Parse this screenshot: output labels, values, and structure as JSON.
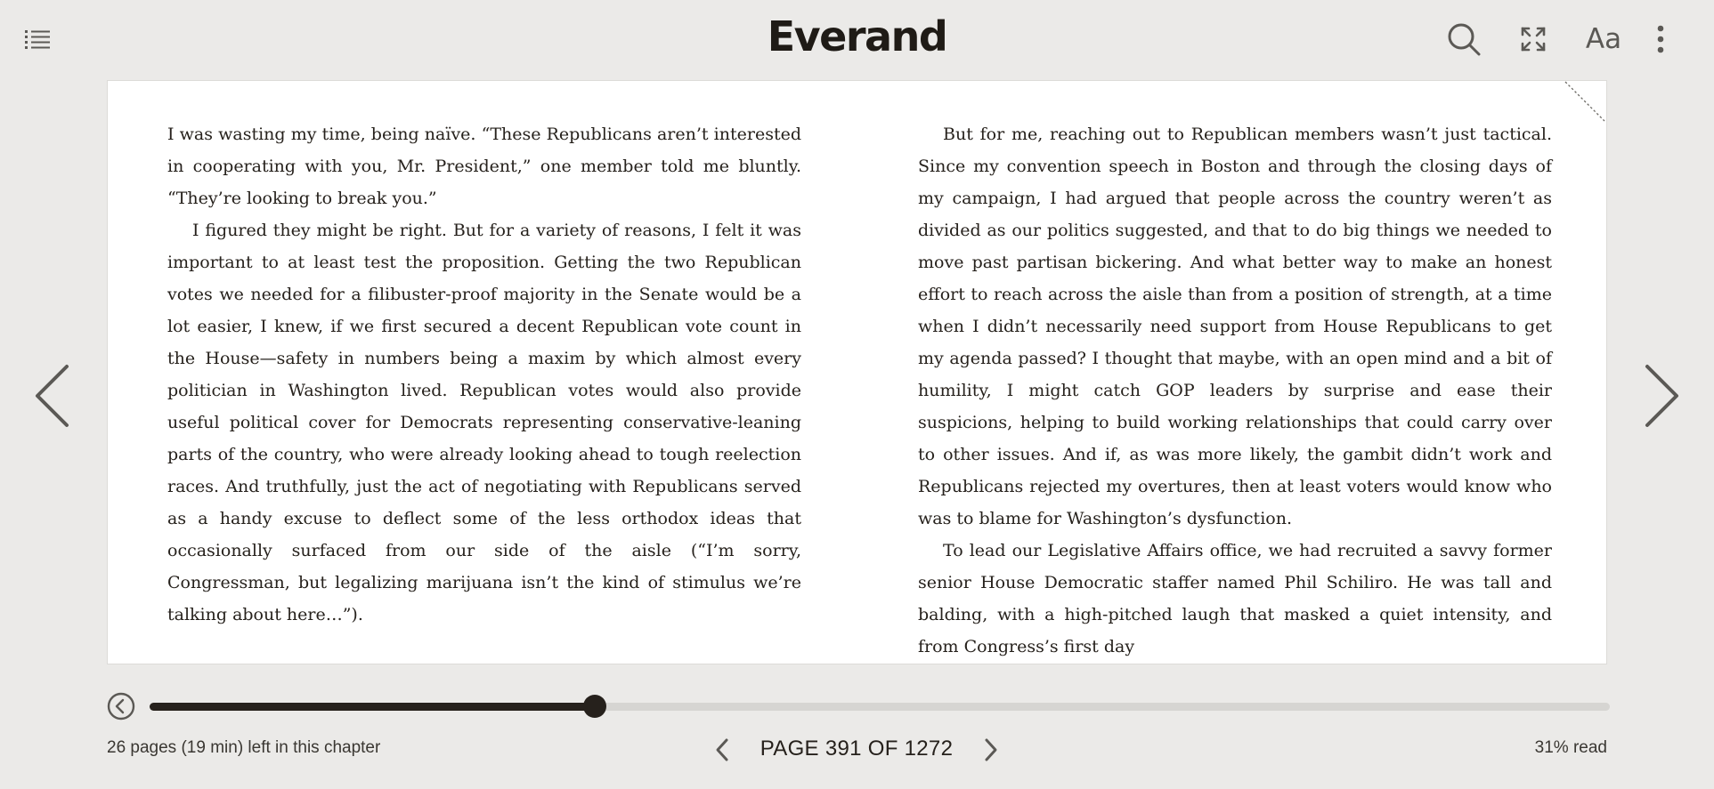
{
  "header": {
    "logo": "Everand",
    "icons": {
      "toc": "list-icon",
      "search": "search-icon",
      "fullscreen": "expand-icon",
      "font": "Aa",
      "more": "more-vertical-icon"
    }
  },
  "content": {
    "left_paragraphs": [
      "I was wasting my time, being naïve. “These Republicans aren’t interested in cooperating with you, Mr. President,” one member told me bluntly. “They’re looking to break you.”",
      "I figured they might be right. But for a variety of reasons, I felt it was important to at least test the proposition. Getting the two Republican votes we needed for a filibuster-proof majority in the Senate would be a lot easier, I knew, if we first secured a decent Republican vote count in the House—safety in numbers being a maxim by which almost every politician in Washington lived. Republican votes would also provide useful political cover for Democrats representing conservative-leaning parts of the country, who were already looking ahead to tough reelection races. And truthfully, just the act of negotiating with Republicans served as a handy excuse to deflect some of the less orthodox ideas that occasionally surfaced from our side of the aisle (“I’m sorry, Congressman, but legalizing marijuana isn’t the kind of stimulus we’re talking about here…”)."
    ],
    "right_paragraphs": [
      "But for me, reaching out to Republican members wasn’t just tactical. Since my convention speech in Boston and through the closing days of my campaign, I had argued that people across the country weren’t as divided as our politics suggested, and that to do big things we needed to move past partisan bickering. And what better way to make an honest effort to reach across the aisle than from a position of strength, at a time when I didn’t necessarily need support from House Republicans to get my agenda passed? I thought that maybe, with an open mind and a bit of humility, I might catch GOP leaders by surprise and ease their suspicions, helping to build working relationships that could carry over to other issues. And if, as was more likely, the gambit didn’t work and Republicans rejected my overtures, then at least voters would know who was to blame for Washington’s dysfunction.",
      "To lead our Legislative Affairs office, we had recruited a savvy former senior House Democratic staffer named Phil Schiliro. He was tall and balding, with a high-pitched laugh that masked a quiet intensity, and from Congress’s first day"
    ]
  },
  "progress": {
    "fraction": 0.305,
    "chapter_left": "26 pages (19 min) left in this chapter",
    "page_label": "PAGE 391 OF 1272",
    "read_label": "31% read"
  },
  "colors": {
    "background": "#ebeae8",
    "page": "#ffffff",
    "ink": "#26211c",
    "track": "#d6d5d2"
  }
}
